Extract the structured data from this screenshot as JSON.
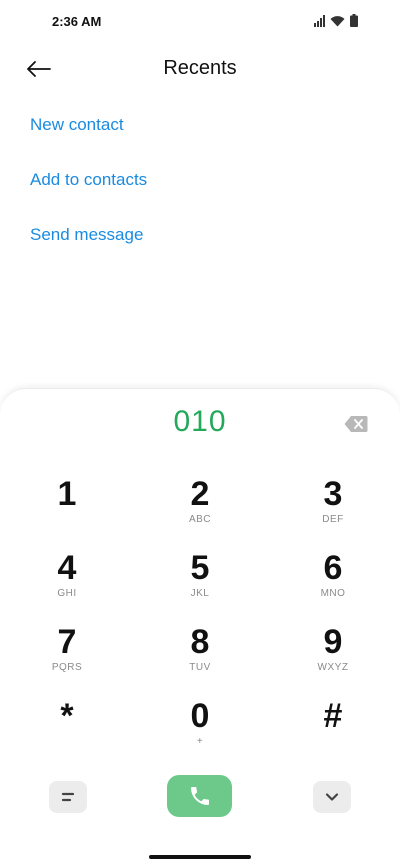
{
  "status_bar": {
    "time": "2:36 AM",
    "icons": [
      "signal-icon",
      "wifi-icon",
      "battery-icon"
    ]
  },
  "header": {
    "back_icon": "arrow-left-icon",
    "title": "Recents"
  },
  "actions": [
    {
      "label": "New contact"
    },
    {
      "label": "Add to contacts"
    },
    {
      "label": "Send message"
    }
  ],
  "dialer": {
    "number": "010",
    "backspace_icon": "backspace-icon",
    "keys": [
      {
        "digit": "1",
        "letters": ""
      },
      {
        "digit": "2",
        "letters": "ABC"
      },
      {
        "digit": "3",
        "letters": "DEF"
      },
      {
        "digit": "4",
        "letters": "GHI"
      },
      {
        "digit": "5",
        "letters": "JKL"
      },
      {
        "digit": "6",
        "letters": "MNO"
      },
      {
        "digit": "7",
        "letters": "PQRS"
      },
      {
        "digit": "8",
        "letters": "TUV"
      },
      {
        "digit": "9",
        "letters": "WXYZ"
      },
      {
        "digit": "*",
        "letters": ""
      },
      {
        "digit": "0",
        "letters": "+"
      },
      {
        "digit": "#",
        "letters": ""
      }
    ],
    "bottom": {
      "menu_icon": "menu-icon",
      "call_icon": "phone-icon",
      "collapse_icon": "chevron-down-icon"
    }
  },
  "colors": {
    "accent_link": "#1a8be0",
    "dialed_number": "#22a95a",
    "call_button": "#6cc98a"
  }
}
